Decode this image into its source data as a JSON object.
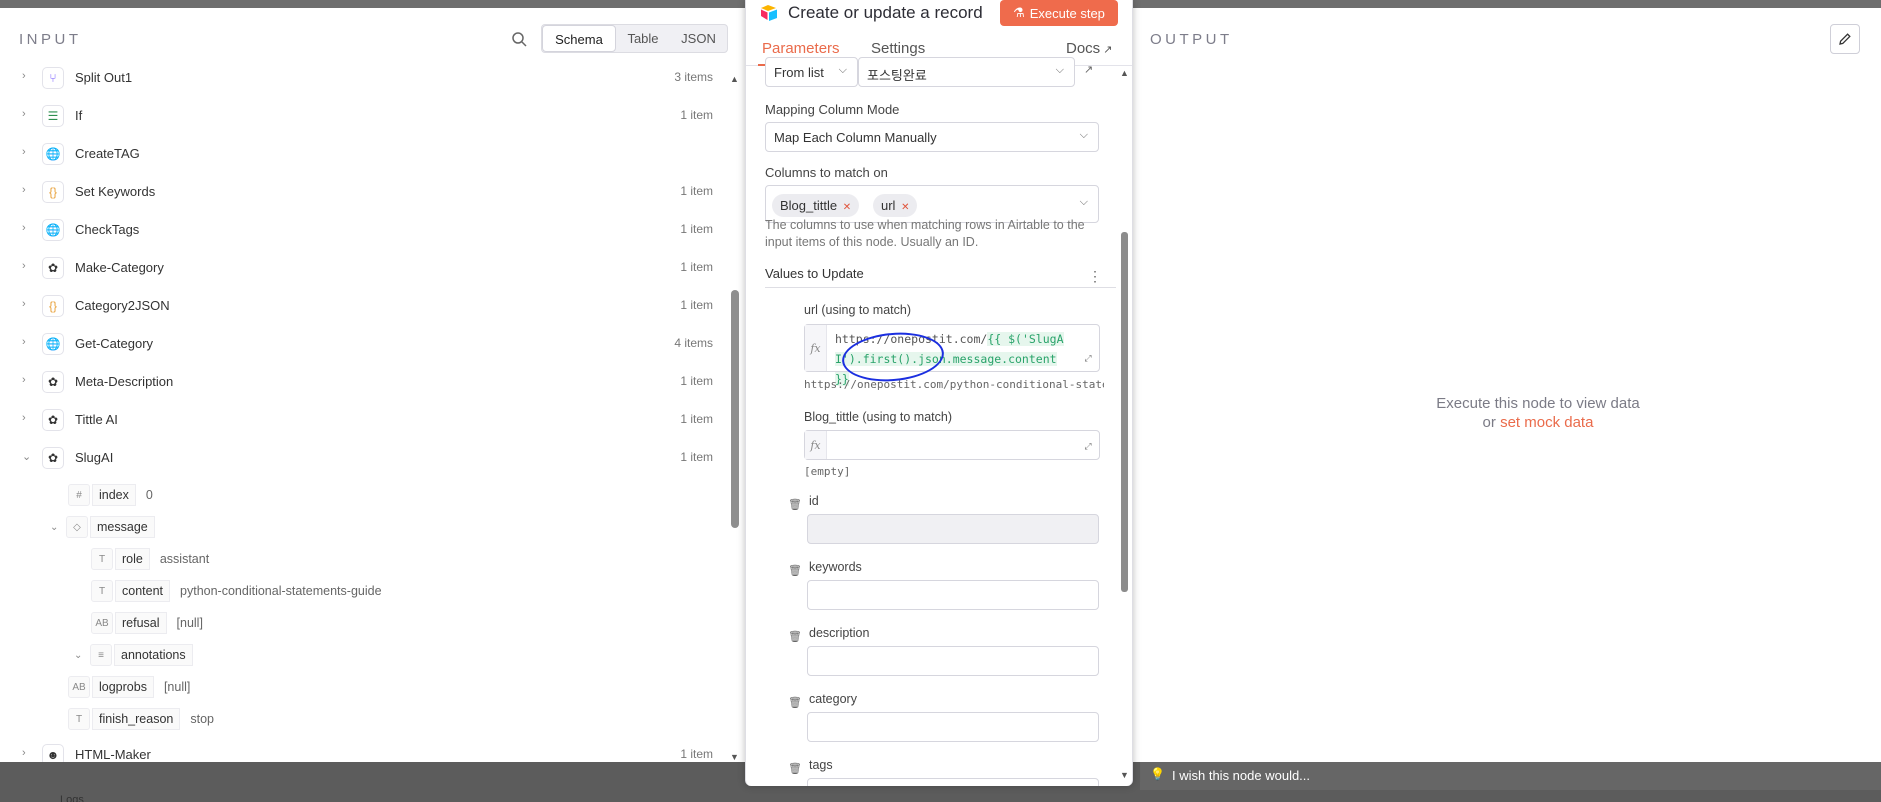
{
  "input": {
    "title": "INPUT",
    "view_tabs": [
      "Schema",
      "Table",
      "JSON"
    ],
    "nodes": [
      {
        "name": "Split Out1",
        "count": "3 items",
        "icon": "split-icon",
        "color": "#7b61ff"
      },
      {
        "name": "If",
        "count": "1 item",
        "icon": "if-icon",
        "color": "#2e8f4f"
      },
      {
        "name": "CreateTAG",
        "count": "",
        "icon": "globe-icon",
        "color": "#5a5ad6"
      },
      {
        "name": "Set Keywords",
        "count": "1 item",
        "icon": "braces-icon",
        "color": "#e8a13a"
      },
      {
        "name": "CheckTags",
        "count": "1 item",
        "icon": "globe-icon",
        "color": "#5a5ad6"
      },
      {
        "name": "Make-Category",
        "count": "1 item",
        "icon": "openai-icon",
        "color": "#333"
      },
      {
        "name": "Category2JSON",
        "count": "1 item",
        "icon": "braces-icon",
        "color": "#e8a13a"
      },
      {
        "name": "Get-Category",
        "count": "4 items",
        "icon": "globe-icon",
        "color": "#5a5ad6"
      },
      {
        "name": "Meta-Description",
        "count": "1 item",
        "icon": "openai-icon",
        "color": "#333"
      },
      {
        "name": "Tittle AI",
        "count": "1 item",
        "icon": "openai-icon",
        "color": "#333"
      },
      {
        "name": "SlugAI",
        "count": "1 item",
        "icon": "openai-icon",
        "color": "#333"
      }
    ],
    "fields": [
      {
        "type": "#",
        "key": "index",
        "value": "0"
      },
      {
        "type": "◇",
        "key": "message",
        "value": ""
      },
      {
        "type": "T",
        "key": "role",
        "value": "assistant"
      },
      {
        "type": "T",
        "key": "content",
        "value": "python-conditional-statements-guide"
      },
      {
        "type": "AB",
        "key": "refusal",
        "value": "[null]"
      },
      {
        "type": "≡",
        "key": "annotations",
        "value": ""
      },
      {
        "type": "AB",
        "key": "logprobs",
        "value": "[null]"
      },
      {
        "type": "T",
        "key": "finish_reason",
        "value": "stop"
      }
    ],
    "last_node": {
      "name": "HTML-Maker",
      "count": "1 item",
      "icon": "robot-icon"
    }
  },
  "ndv": {
    "title": "Create or update a record",
    "execute_label": "Execute step",
    "tabs": {
      "parameters": "Parameters",
      "settings": "Settings",
      "docs": "Docs"
    },
    "table": {
      "mode": "From list",
      "value": "포스팅완료"
    },
    "mapping": {
      "label": "Mapping Column Mode",
      "value": "Map Each Column Manually"
    },
    "match": {
      "label": "Columns to match on",
      "chips": [
        "Blog_tittle",
        "url"
      ],
      "hint": "The columns to use when matching rows in Airtable to the input items of this node. Usually an ID."
    },
    "values_label": "Values to Update",
    "url_field": {
      "label": "url (using to match)",
      "code_plain": "https://onepostit.com/",
      "code_expr": "{{ $('SlugAI').first().json.message.content }}",
      "result": "https://onepostit.com/python-conditional-statem···"
    },
    "blog_field": {
      "label": "Blog_tittle (using to match)",
      "result": "[empty]"
    },
    "extra_fields": [
      "id",
      "keywords",
      "description",
      "category",
      "tags"
    ]
  },
  "output": {
    "title": "OUTPUT",
    "message_line1": "Execute this node to view data",
    "message_or": "or",
    "mock_link": "set mock data"
  },
  "wish": {
    "text": "I wish this node would..."
  },
  "footer": {
    "logs": "Logs"
  },
  "colors": {
    "accent": "#ea6b4b",
    "expr_green": "#29a36a",
    "annotation_blue": "#1b2fe0"
  }
}
